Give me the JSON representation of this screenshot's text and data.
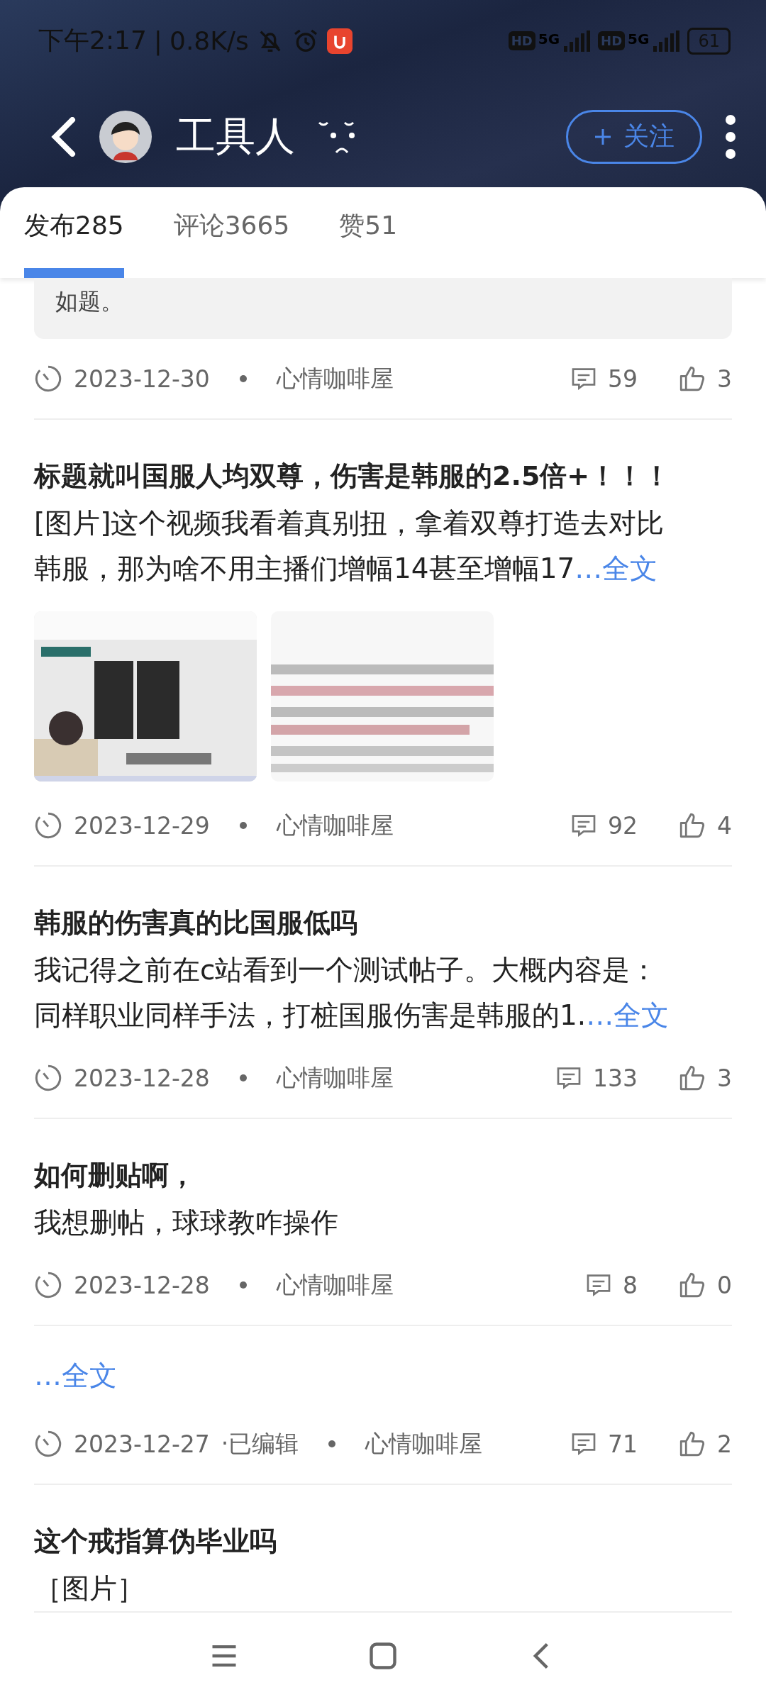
{
  "status_bar": {
    "time": "下午2:17",
    "separator": "|",
    "net_speed": "0.8K/s",
    "sims": [
      {
        "hd": "HD",
        "net": "5G"
      },
      {
        "hd": "HD",
        "net": "5G"
      }
    ],
    "battery": "61"
  },
  "header": {
    "username": "工具人",
    "follow_button": "关注"
  },
  "tabs": [
    {
      "label": "发布285",
      "selected": true
    },
    {
      "label": "评论3665",
      "selected": false
    },
    {
      "label": "赞51",
      "selected": false
    }
  ],
  "posts": [
    {
      "quote": "如题。",
      "date": "2023-12-30",
      "circle": "心情咖啡屋",
      "comments": "59",
      "likes": "3"
    },
    {
      "title": "标题就叫国服人均双尊，伤害是韩服的2.5倍+！！！",
      "body": [
        "[图片]这个视频我看着真别扭，拿着双尊打造去对比",
        "韩服，那为啥不用主播们增幅14甚至增幅17"
      ],
      "more": "…全文",
      "images": [
        {
          "kind": "picture"
        },
        {
          "kind": "picture"
        }
      ],
      "date": "2023-12-29",
      "circle": "心情咖啡屋",
      "comments": "92",
      "likes": "4"
    },
    {
      "title": "韩服的伤害真的比国服低吗",
      "body": [
        "我记得之前在c站看到一个测试帖子。大概内容是：",
        "同样职业同样手法，打桩国服伤害是韩服的1."
      ],
      "more": "…全文",
      "date": "2023-12-28",
      "circle": "心情咖啡屋",
      "comments": "133",
      "likes": "3"
    },
    {
      "title": "如何删贴啊，",
      "body": [
        "我想删帖，球球教咋操作"
      ],
      "date": "2023-12-28",
      "circle": "心情咖啡屋",
      "comments": "8",
      "likes": "0"
    },
    {
      "more": "…全文",
      "date": "2023-12-27",
      "edited": "·已编辑",
      "circle": "心情咖啡屋",
      "comments": "71",
      "likes": "2"
    },
    {
      "title": "这个戒指算伪毕业吗",
      "body": [
        "［图片］"
      ]
    }
  ]
}
